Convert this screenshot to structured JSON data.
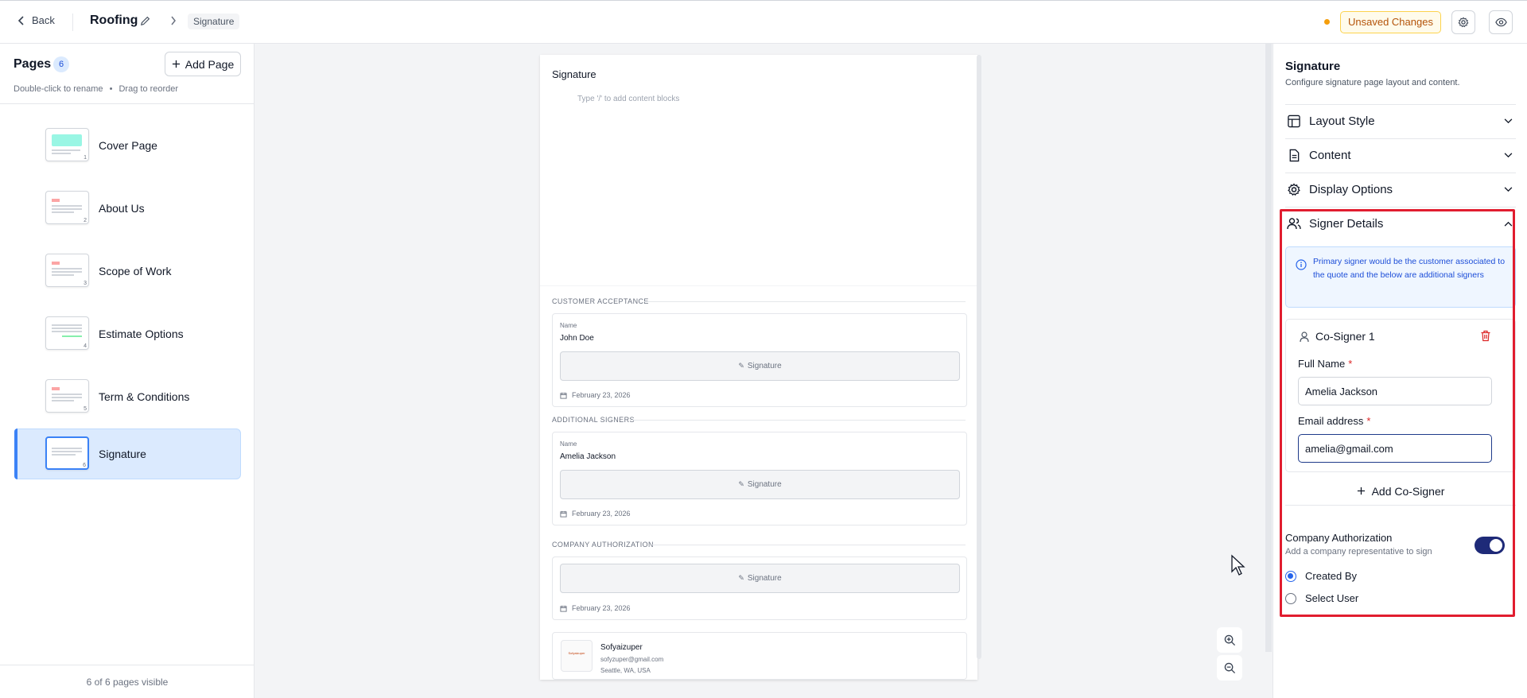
{
  "topbar": {
    "back_label": "Back",
    "doc_title": "Roofing",
    "breadcrumb": "Signature",
    "unsaved_label": "Unsaved Changes",
    "settings_icon": "gear-icon",
    "preview_icon": "eye-icon",
    "unsaved_color": "#f59e0b"
  },
  "sidebar": {
    "title": "Pages",
    "count": "6",
    "add_page_label": "Add Page",
    "hint_rename": "Double-click to rename",
    "hint_reorder": "Drag to reorder",
    "footer": "6 of 6 pages visible",
    "pages": [
      {
        "label": "Cover Page",
        "num": "1"
      },
      {
        "label": "About Us",
        "num": "2"
      },
      {
        "label": "Scope of Work",
        "num": "3"
      },
      {
        "label": "Estimate Options",
        "num": "4"
      },
      {
        "label": "Term & Conditions",
        "num": "5"
      },
      {
        "label": "Signature",
        "num": "6"
      }
    ]
  },
  "document": {
    "heading": "Signature",
    "placeholder": "Type '/' to add content blocks",
    "customer_section": "CUSTOMER ACCEPTANCE",
    "additional_section": "ADDITIONAL SIGNERS",
    "company_section": "COMPANY AUTHORIZATION",
    "name_label": "Name",
    "signature_label": "Signature",
    "customer_name": "John Doe",
    "additional_name": "Amelia Jackson",
    "date": "February 23, 2026",
    "company": {
      "logo_text": "Sofyaizuper",
      "name": "Sofyaizuper",
      "email": "sofyzuper@gmail.com",
      "location": "Seattle, WA, USA"
    }
  },
  "panel": {
    "title": "Signature",
    "subtitle": "Configure signature page layout and content.",
    "sections": {
      "layout": "Layout Style",
      "content": "Content",
      "display": "Display Options",
      "signer": "Signer Details"
    },
    "info": "Primary signer would be the customer associated to the quote and the below are additional signers",
    "cosigner": {
      "title": "Co-Signer 1",
      "full_name_label": "Full Name",
      "full_name_value": "Amelia Jackson",
      "email_label": "Email address",
      "email_value": "amelia@gmail.com"
    },
    "add_cosigner_label": "Add Co-Signer",
    "company_auth": {
      "title": "Company Authorization",
      "subtitle": "Add a company representative to sign",
      "enabled": true,
      "options": [
        "Created By",
        "Select User"
      ],
      "selected": "Created By"
    },
    "highlight_color": "#e11d2f"
  }
}
